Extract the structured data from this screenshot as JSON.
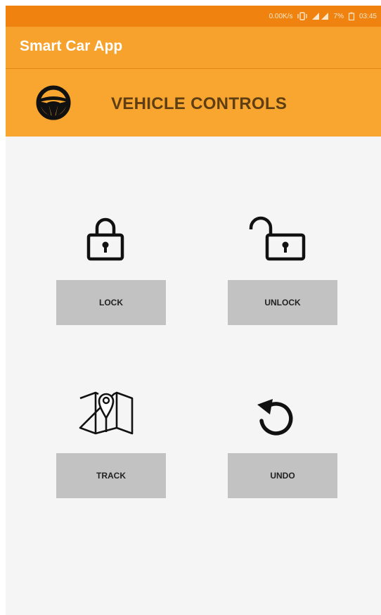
{
  "status_bar": {
    "speed": "0.00K/s",
    "battery": "7%",
    "time": "03:45"
  },
  "app_bar": {
    "title": "Smart Car App"
  },
  "header": {
    "title": "VEHICLE CONTROLS",
    "icon": "steering-wheel-icon"
  },
  "controls": [
    {
      "label": "LOCK",
      "icon": "lock-icon"
    },
    {
      "label": "UNLOCK",
      "icon": "unlock-icon"
    },
    {
      "label": "TRACK",
      "icon": "map-icon"
    },
    {
      "label": "UNDO",
      "icon": "undo-icon"
    }
  ],
  "colors": {
    "status_bar": "#f0820f",
    "app_bar": "#f7a22d",
    "header_band": "#f8a62f",
    "button": "#c2c2c2",
    "background": "#f5f5f5"
  }
}
